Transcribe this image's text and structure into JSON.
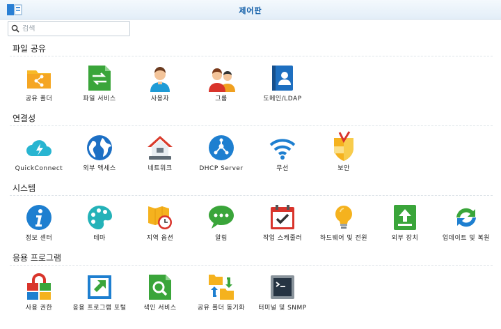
{
  "window": {
    "title": "제어판"
  },
  "search": {
    "placeholder": "검색",
    "value": ""
  },
  "sections": [
    {
      "title": "파일 공유",
      "items": [
        "공유 폴더",
        "파일 서비스",
        "사용자",
        "그룹",
        "도메인/LDAP"
      ]
    },
    {
      "title": "연결성",
      "items": [
        "QuickConnect",
        "외부 액세스",
        "네트워크",
        "DHCP Server",
        "무선",
        "보안"
      ]
    },
    {
      "title": "시스템",
      "items": [
        "정보 센터",
        "테마",
        "지역 옵션",
        "알림",
        "작업 스케줄러",
        "하드웨어 및 전원",
        "외부 장치",
        "업데이트 및 복원"
      ]
    },
    {
      "title": "응용 프로그램",
      "items": [
        "사용 권한",
        "응용 프로그램 포털",
        "색인 서비스",
        "공유 폴더 동기화",
        "터미널 및 SNMP"
      ]
    }
  ],
  "icons": {
    "shared-folder": "shared-folder-icon",
    "file-services": "file-services-icon",
    "user": "user-icon",
    "group": "group-icon",
    "domain-ldap": "domain-ldap-icon",
    "quickconnect": "quickconnect-icon",
    "external-access": "globe-icon",
    "network": "house-icon",
    "dhcp": "dhcp-icon",
    "wireless": "wifi-icon",
    "security": "shield-icon",
    "info-center": "info-icon",
    "theme": "palette-icon",
    "regional": "map-clock-icon",
    "notification": "chat-icon",
    "task-scheduler": "calendar-check-icon",
    "hardware-power": "lightbulb-icon",
    "external-devices": "upload-icon",
    "update-restore": "refresh-icon",
    "privileges": "lock-icon",
    "app-portal": "portal-arrow-icon",
    "indexing": "magnifier-icon",
    "folder-sync": "folder-sync-icon",
    "terminal-snmp": "terminal-icon"
  },
  "colors": {
    "title": "#0b5aa6",
    "accent": "#1e7fd0"
  }
}
